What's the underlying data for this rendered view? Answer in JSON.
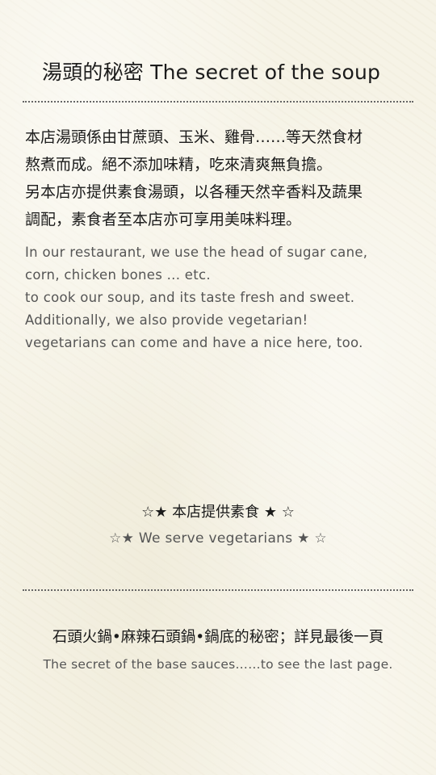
{
  "header": {
    "title": "湯頭的秘密 The secret of the soup"
  },
  "intro_zh": [
    "本店湯頭係由甘蔗頭、玉米、雞骨……等天然食材",
    "熬煮而成。絕不添加味精，吃來清爽無負擔。",
    "另本店亦提供素食湯頭，以各種天然辛香料及蔬果",
    "調配，素食者至本店亦可享用美味料理。"
  ],
  "intro_en": [
    "In our restaurant, we use the head of sugar cane,",
    "corn, chicken bones ... etc.",
    "to cook our soup, and its taste fresh and sweet.",
    "Additionally, we also provide vegetarian!",
    "vegetarians can come and have a nice here, too."
  ],
  "vegetarian": {
    "zh": "☆★ 本店提供素食 ★ ☆",
    "en": "☆★ We serve vegetarians ★ ☆"
  },
  "footer": {
    "zh": "石頭火鍋•麻辣石頭鍋•鍋底的秘密；詳見最後一頁",
    "en": "The secret of the base sauces……to see the last page."
  }
}
